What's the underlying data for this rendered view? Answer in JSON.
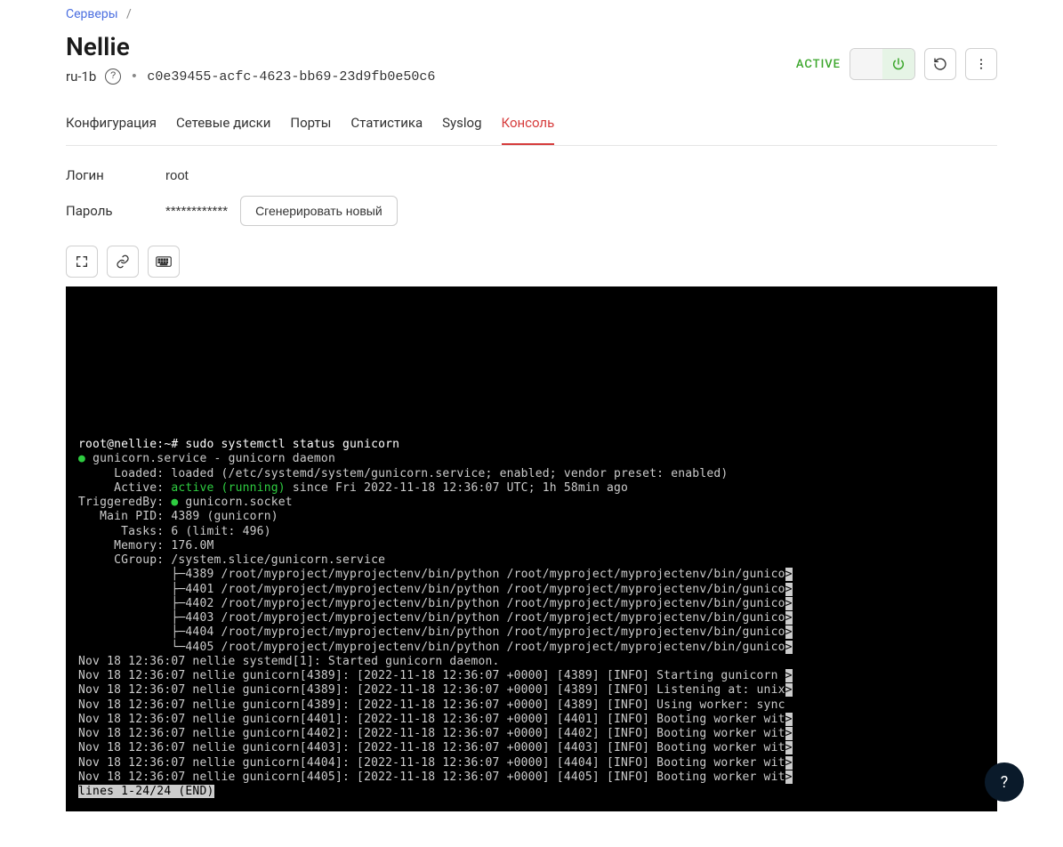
{
  "breadcrumb": {
    "servers": "Серверы"
  },
  "header": {
    "title": "Nellie",
    "region": "ru-1b",
    "uuid": "c0e39455-acfc-4623-bb69-23d9fb0e50c6",
    "status": "ACTIVE"
  },
  "tabs": [
    {
      "id": "config",
      "label": "Конфигурация",
      "active": false
    },
    {
      "id": "disks",
      "label": "Сетевые диски",
      "active": false
    },
    {
      "id": "ports",
      "label": "Порты",
      "active": false
    },
    {
      "id": "stats",
      "label": "Статистика",
      "active": false
    },
    {
      "id": "syslog",
      "label": "Syslog",
      "active": false
    },
    {
      "id": "console",
      "label": "Консоль",
      "active": true
    }
  ],
  "credentials": {
    "login_label": "Логин",
    "login_value": "root",
    "password_label": "Пароль",
    "password_value": "************",
    "generate_label": "Сгенерировать новый"
  },
  "help": "?",
  "terminal": {
    "lines": [
      [
        {
          "t": "root@nellie:~# sudo systemctl status gunicorn",
          "c": "cmd"
        }
      ],
      [
        {
          "t": "● ",
          "c": "green"
        },
        {
          "t": "gunicorn.service - gunicorn daemon",
          "c": "grey"
        }
      ],
      [
        {
          "t": "     Loaded: loaded (/etc/systemd/system/gunicorn.service; enabled; vendor preset: enabled)",
          "c": "grey"
        }
      ],
      [
        {
          "t": "     Active: ",
          "c": "grey"
        },
        {
          "t": "active (running)",
          "c": "green"
        },
        {
          "t": " since Fri 2022-11-18 12:36:07 UTC; 1h 58min ago",
          "c": "grey"
        }
      ],
      [
        {
          "t": "TriggeredBy: ",
          "c": "grey"
        },
        {
          "t": "●",
          "c": "green"
        },
        {
          "t": " gunicorn.socket",
          "c": "grey"
        }
      ],
      [
        {
          "t": "   Main PID: 4389 (gunicorn)",
          "c": "grey"
        }
      ],
      [
        {
          "t": "      Tasks: 6 (limit: 496)",
          "c": "grey"
        }
      ],
      [
        {
          "t": "     Memory: 176.0M",
          "c": "grey"
        }
      ],
      [
        {
          "t": "     CGroup: /system.slice/gunicorn.service",
          "c": "grey"
        }
      ],
      [
        {
          "t": "             ├─4389 /root/myproject/myprojectenv/bin/python /root/myproject/myprojectenv/bin/gunico",
          "c": "grey"
        },
        {
          "t": ">",
          "c": "hl"
        }
      ],
      [
        {
          "t": "             ├─4401 /root/myproject/myprojectenv/bin/python /root/myproject/myprojectenv/bin/gunico",
          "c": "grey"
        },
        {
          "t": ">",
          "c": "hl"
        }
      ],
      [
        {
          "t": "             ├─4402 /root/myproject/myprojectenv/bin/python /root/myproject/myprojectenv/bin/gunico",
          "c": "grey"
        },
        {
          "t": ">",
          "c": "hl"
        }
      ],
      [
        {
          "t": "             ├─4403 /root/myproject/myprojectenv/bin/python /root/myproject/myprojectenv/bin/gunico",
          "c": "grey"
        },
        {
          "t": ">",
          "c": "hl"
        }
      ],
      [
        {
          "t": "             ├─4404 /root/myproject/myprojectenv/bin/python /root/myproject/myprojectenv/bin/gunico",
          "c": "grey"
        },
        {
          "t": ">",
          "c": "hl"
        }
      ],
      [
        {
          "t": "             └─4405 /root/myproject/myprojectenv/bin/python /root/myproject/myprojectenv/bin/gunico",
          "c": "grey"
        },
        {
          "t": ">",
          "c": "hl"
        }
      ],
      [
        {
          "t": "",
          "c": "grey"
        }
      ],
      [
        {
          "t": "Nov 18 12:36:07 nellie systemd[1]: Started gunicorn daemon.",
          "c": "grey"
        }
      ],
      [
        {
          "t": "Nov 18 12:36:07 nellie gunicorn[4389]: [2022-11-18 12:36:07 +0000] [4389] [INFO] Starting gunicorn ",
          "c": "grey"
        },
        {
          "t": ">",
          "c": "hl"
        }
      ],
      [
        {
          "t": "Nov 18 12:36:07 nellie gunicorn[4389]: [2022-11-18 12:36:07 +0000] [4389] [INFO] Listening at: unix",
          "c": "grey"
        },
        {
          "t": ">",
          "c": "hl"
        }
      ],
      [
        {
          "t": "Nov 18 12:36:07 nellie gunicorn[4389]: [2022-11-18 12:36:07 +0000] [4389] [INFO] Using worker: sync",
          "c": "grey"
        }
      ],
      [
        {
          "t": "Nov 18 12:36:07 nellie gunicorn[4401]: [2022-11-18 12:36:07 +0000] [4401] [INFO] Booting worker wit",
          "c": "grey"
        },
        {
          "t": ">",
          "c": "hl"
        }
      ],
      [
        {
          "t": "Nov 18 12:36:07 nellie gunicorn[4402]: [2022-11-18 12:36:07 +0000] [4402] [INFO] Booting worker wit",
          "c": "grey"
        },
        {
          "t": ">",
          "c": "hl"
        }
      ],
      [
        {
          "t": "Nov 18 12:36:07 nellie gunicorn[4403]: [2022-11-18 12:36:07 +0000] [4403] [INFO] Booting worker wit",
          "c": "grey"
        },
        {
          "t": ">",
          "c": "hl"
        }
      ],
      [
        {
          "t": "Nov 18 12:36:07 nellie gunicorn[4404]: [2022-11-18 12:36:07 +0000] [4404] [INFO] Booting worker wit",
          "c": "grey"
        },
        {
          "t": ">",
          "c": "hl"
        }
      ],
      [
        {
          "t": "Nov 18 12:36:07 nellie gunicorn[4405]: [2022-11-18 12:36:07 +0000] [4405] [INFO] Booting worker wit",
          "c": "grey"
        },
        {
          "t": ">",
          "c": "hl"
        }
      ],
      [
        {
          "t": "lines 1-24/24 (END)",
          "c": "end"
        }
      ]
    ]
  }
}
